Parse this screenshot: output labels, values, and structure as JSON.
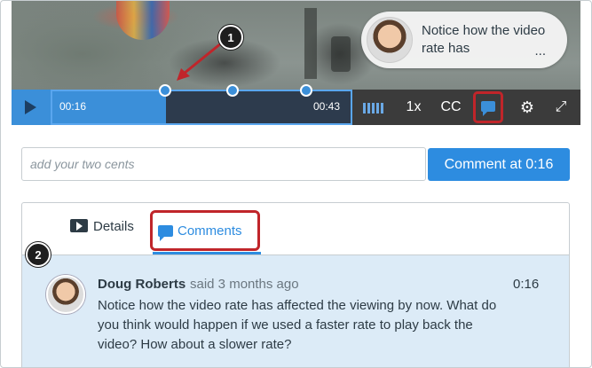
{
  "player": {
    "current_time": "00:16",
    "duration": "00:43",
    "played_fraction": 0.37,
    "comment_marker_count": 3,
    "speed": "1x",
    "captions": "CC",
    "bubble": {
      "text": "Notice how the video rate has",
      "ellipsis": "..."
    }
  },
  "callouts": {
    "one": "1",
    "two": "2"
  },
  "composer": {
    "placeholder": "add your two cents",
    "submit_label": "Comment at 0:16"
  },
  "tabs": {
    "details": "Details",
    "comments": "Comments"
  },
  "comment": {
    "author": "Doug Roberts",
    "meta": "said 3 months ago",
    "timestamp": "0:16",
    "body": "Notice how the video rate has affected the viewing by now. What do you think would happen if we used a faster rate to play back the video? How about a slower rate?"
  },
  "colors": {
    "accent": "#2d8ce0",
    "highlight": "#c0252a",
    "comment_bg": "#dcebf7",
    "control_bar": "#3b3b3b"
  }
}
